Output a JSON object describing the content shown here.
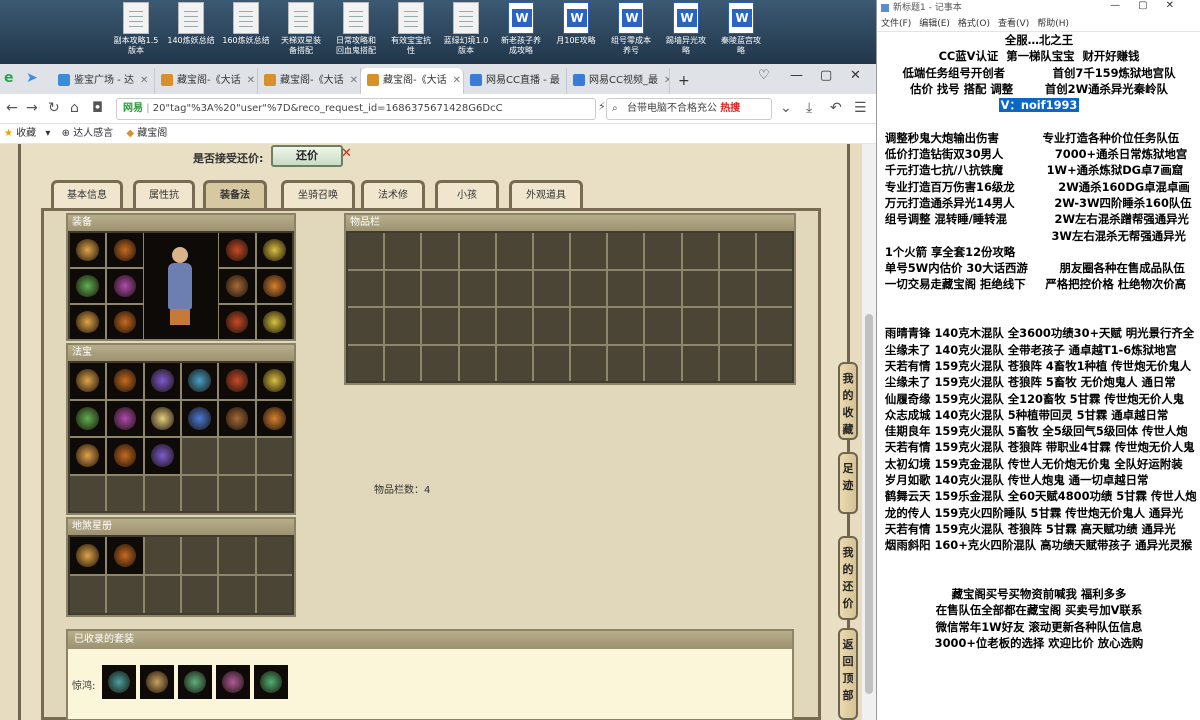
{
  "desktop": {
    "icons": [
      {
        "label": "副本攻略1.5\n版本",
        "type": "txt"
      },
      {
        "label": "140炼妖总结",
        "type": "txt"
      },
      {
        "label": "160炼妖总结",
        "type": "txt"
      },
      {
        "label": "天梯双星装\n备搭配",
        "type": "txt"
      },
      {
        "label": "日常攻略和\n回血鬼搭配",
        "type": "txt"
      },
      {
        "label": "有效宝宝抗\n性",
        "type": "txt"
      },
      {
        "label": "蓝绿幻境1.0\n版本",
        "type": "txt"
      },
      {
        "label": "新老孩子养\n成攻略",
        "type": "word"
      },
      {
        "label": "月10E攻略",
        "type": "word"
      },
      {
        "label": "组号零成本\n养号",
        "type": "word"
      },
      {
        "label": "踢墙异光攻\n略",
        "type": "word"
      },
      {
        "label": "秦陵蓝宫攻\n略",
        "type": "word"
      }
    ]
  },
  "browser": {
    "tabs": [
      {
        "label": "鉴宝广场 - 达",
        "icon_color": "#3b8bd8"
      },
      {
        "label": "藏宝阁-《大话",
        "icon_color": "#d8902b"
      },
      {
        "label": "藏宝阁-《大话",
        "icon_color": "#d8902b"
      },
      {
        "label": "藏宝阁-《大话",
        "icon_color": "#d8902b",
        "active": true
      },
      {
        "label": "网易CC直播 - 最",
        "icon_color": "#3b7bd8"
      },
      {
        "label": "网易CC视频_最",
        "icon_color": "#3b7bd8"
      }
    ],
    "new_tab": "+",
    "url_prefix": "网易",
    "url": "20\"tag\"%3A%20\"user\"%7D&reco_request_id=1686375671428G6DcC",
    "search_text": "台带电脑不合格充公",
    "search_hot": "热搜",
    "bookmarks": [
      {
        "label": "收藏"
      },
      {
        "label": "达人感言"
      },
      {
        "label": "藏宝阁"
      }
    ]
  },
  "game": {
    "bargain_label": "是否接受还价:",
    "bargain_button": "还价",
    "tabs": [
      "基本信息",
      "属性抗性",
      "装备法宝",
      "坐骑召唤兽",
      "法术修正",
      "小孩",
      "外观道具"
    ],
    "active_tab": "装备法宝",
    "equip_title": "装备",
    "fabao_title": "法宝",
    "star_title": "地煞星册",
    "goods_title": "物品栏",
    "goods_count_label": "物品栏数：4",
    "collected_title": "已收录的套装",
    "collected_row_label": "惊鸿:",
    "side_tabs": [
      {
        "label": "我的收藏"
      },
      {
        "label": "足迹"
      },
      {
        "label": "我的还价"
      },
      {
        "label": "返回顶部"
      }
    ]
  },
  "notepad": {
    "title": "新标题1 - 记事本",
    "menu": [
      "文件(F)",
      "编辑(E)",
      "格式(O)",
      "查看(V)",
      "帮助(H)"
    ],
    "lines": [
      {
        "text": "全服…北之王",
        "align": "center"
      },
      {
        "text": "CC蓝V认证  第一梯队宝宝  财开好赚钱",
        "align": "center"
      },
      {
        "text": "低端任务组号开创者            首创7千159炼狱地宫队",
        "align": "center"
      },
      {
        "text": "估价 找号 搭配 调整        首创2W通杀异光秦岭队",
        "align": "center"
      },
      {
        "text": "V：noif1993",
        "align": "center",
        "highlight": true
      },
      {
        "text": ""
      },
      {
        "text": "  调整秒鬼大炮输出伤害           专业打造各种价位任务队伍"
      },
      {
        "text": "  低价打造钻街双30男人             7000+通杀日常炼狱地宫"
      },
      {
        "text": "  千元打造七抗/八抗铁魔           1W+通杀炼狱DG卓7画窟"
      },
      {
        "text": "  专业打造百万伤害16级龙           2W通杀160DG卓混卓画"
      },
      {
        "text": "  万元打造通杀异光14男人          2W-3W四阶睡杀160队伍"
      },
      {
        "text": "  组号调整 混转睡/睡转混            2W左右混杀蹭帮强通异光"
      },
      {
        "text": "                                            3W左右混杀无帮强通异光"
      },
      {
        "text": "  1个火箭 享全套12份攻略"
      },
      {
        "text": "  单号5W内估价 30大话西游        朋友圈各种在售成品队伍"
      },
      {
        "text": "  一切交易走藏宝阁 拒绝线下     严格把控价格 杜绝物次价高"
      },
      {
        "text": ""
      },
      {
        "text": ""
      },
      {
        "text": "  雨晴青锋 140克木混队 全3600功绩30+天赋 明光景行齐全"
      },
      {
        "text": "  尘缘未了 140克火混队 全带老孩子 通卓越T1-6炼狱地宫"
      },
      {
        "text": "  天若有情 159克火混队 苍狼阵 4畜牧1种植 传世炮无价鬼人"
      },
      {
        "text": "  尘缘未了 159克火混队 苍狼阵 5畜牧 无价炮鬼人 通日常"
      },
      {
        "text": "  仙履奇缘 159克火混队 全120畜牧 5甘霖 传世炮无价人鬼"
      },
      {
        "text": "  众志成城 140克火混队 5种植带回灵 5甘霖 通卓越日常"
      },
      {
        "text": "  佳期良年 159克火混队 5畜牧 全5级回气5级回体 传世人炮"
      },
      {
        "text": "  天若有情 159克火混队 苍狼阵 带职业4甘霖 传世炮无价人鬼"
      },
      {
        "text": "  太初幻境 159克金混队 传世人无价炮无价鬼 全队好运附装"
      },
      {
        "text": "  岁月如歌 140克火混队 传世人炮鬼 通一切卓越日常"
      },
      {
        "text": "  鹤舞云天 159乐金混队 全60天赋4800功绩 5甘霖 传世人炮"
      },
      {
        "text": "  龙的传人 159克火四阶睡队 5甘霖 传世炮无价鬼人 通异光"
      },
      {
        "text": "  天若有情 159克火混队 苍狼阵 5甘霖 高天赋功绩 通异光"
      },
      {
        "text": "  烟雨斜阳 160+克火四阶混队 高功绩天赋带孩子 通异光灵猴"
      },
      {
        "text": ""
      },
      {
        "text": ""
      },
      {
        "text": "藏宝阁买号买物资前喊我 福利多多",
        "align": "center"
      },
      {
        "text": "在售队伍全部都在藏宝阁 买卖号加V联系",
        "align": "center"
      },
      {
        "text": "微信常年1W好友 滚动更新各种队伍信息",
        "align": "center"
      },
      {
        "text": "3000+位老板的选择 欢迎比价 放心选购",
        "align": "center"
      }
    ]
  },
  "colors": {
    "page_bg": "#e7dcc0",
    "panel_dark": "#3f3b2f",
    "highlight": "#0b67c6"
  }
}
